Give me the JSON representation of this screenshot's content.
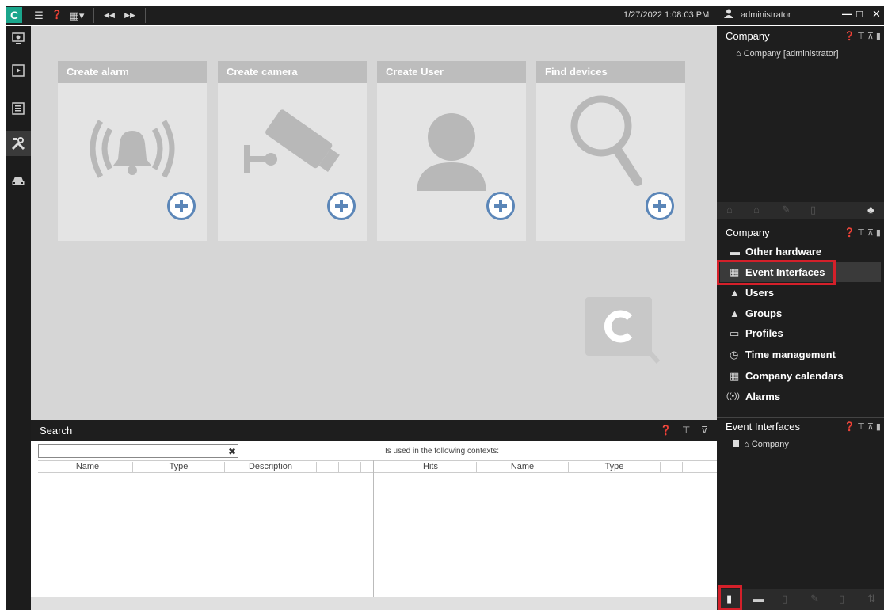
{
  "topbar": {
    "logo": "C",
    "menu_icon": "☰",
    "help_icon": "❓",
    "layout_icon": "▦▾",
    "back_icon": "◀◀",
    "forward_icon": "▶▶",
    "clock": "1/27/2022 1:08:03 PM",
    "user": "administrator",
    "minimize": "—",
    "maximize": "□",
    "close": "✕"
  },
  "leftnav": [
    "monitor-icon",
    "video-player-icon",
    "event-list-icon",
    "tools-icon",
    "car-icon"
  ],
  "tiles": [
    {
      "label": "Create alarm"
    },
    {
      "label": "Create camera"
    },
    {
      "label": "Create User"
    },
    {
      "label": "Find devices"
    }
  ],
  "search": {
    "title": "Search",
    "clear": "✖",
    "context_label": "Is used in the following contexts:",
    "left_cols": [
      "Name",
      "Type",
      "Description"
    ],
    "right_cols": [
      "Hits",
      "Name",
      "Type"
    ]
  },
  "panels": {
    "top": {
      "title": "Company",
      "node": "Company [administrator]"
    },
    "middle": {
      "title": "Company",
      "items": [
        {
          "label": "Other hardware",
          "icon": "▬"
        },
        {
          "label": "Event Interfaces",
          "icon": "▦"
        },
        {
          "label": "Users",
          "icon": "▲"
        },
        {
          "label": "Groups",
          "icon": "▲"
        },
        {
          "label": "Profiles",
          "icon": "▭"
        },
        {
          "label": "Time management",
          "icon": "◷"
        },
        {
          "label": "Company calendars",
          "icon": "▦"
        },
        {
          "label": "Alarms",
          "icon": "((•))"
        }
      ]
    },
    "bottom": {
      "title": "Event Interfaces",
      "node": "Company"
    }
  },
  "colors": {
    "accent": "#1aa68c",
    "plus": "#5b86b8",
    "highlight": "#d4202a"
  }
}
